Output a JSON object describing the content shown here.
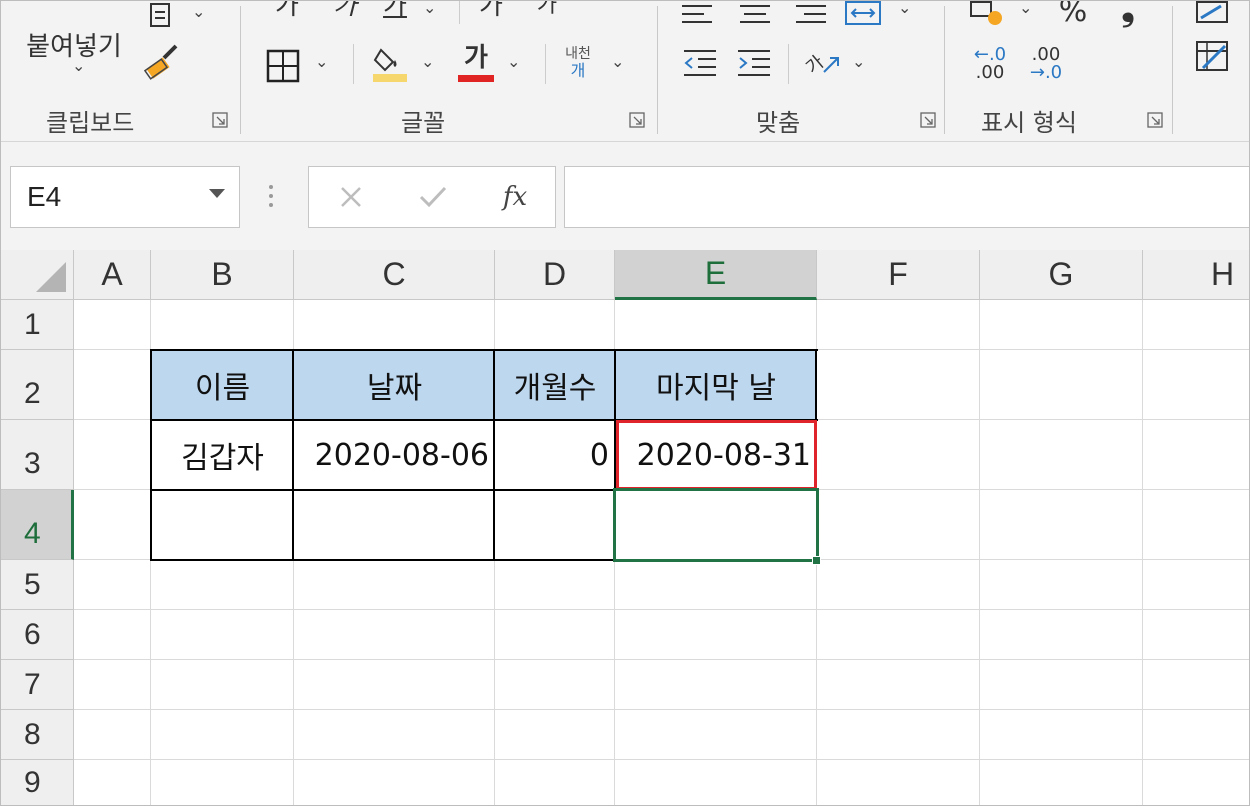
{
  "ribbon": {
    "clipboard": {
      "paste_label": "붙여넣기",
      "group_label": "클립보드"
    },
    "font": {
      "top_row_glyphs": [
        "가",
        "가",
        "가",
        "가",
        "가"
      ],
      "font_color_glyph": "가",
      "phonetic_top": "내천",
      "phonetic_bottom": "개",
      "group_label": "글꼴",
      "fill_color": "#f5d76e",
      "font_color": "#e02424"
    },
    "alignment": {
      "orientation_glyph": "가",
      "group_label": "맞춤"
    },
    "number": {
      "percent": "%",
      "comma": "❟",
      "increase_decimal_top": "←.0",
      "increase_decimal_bottom": ".00",
      "decrease_decimal_top": ".00",
      "decrease_decimal_bottom": "→.0",
      "group_label": "표시 형식"
    }
  },
  "formula_bar": {
    "name_box": "E4",
    "fx": "fx",
    "formula": ""
  },
  "sheet": {
    "columns": [
      "A",
      "B",
      "C",
      "D",
      "E",
      "F",
      "G",
      "H"
    ],
    "rows": [
      "1",
      "2",
      "3",
      "4",
      "5",
      "6",
      "7",
      "8",
      "9"
    ],
    "active_cell": "E4",
    "table": {
      "headers": [
        "이름",
        "날짜",
        "개월수",
        "마지막 날"
      ],
      "row3": [
        "김갑자",
        "2020-08-06",
        "0",
        "2020-08-31"
      ]
    },
    "header_fill": "#bdd7ee",
    "highlight_color": "#e0242b",
    "accent": "#217346"
  }
}
